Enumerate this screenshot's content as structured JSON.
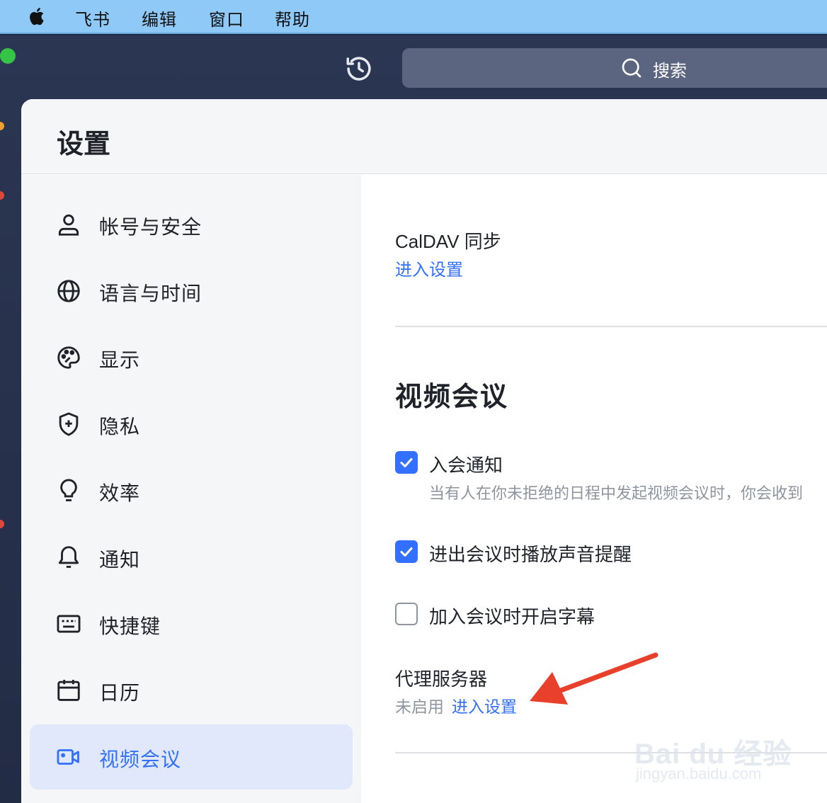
{
  "menubar": {
    "items": [
      "飞书",
      "编辑",
      "窗口",
      "帮助"
    ]
  },
  "toolbar": {
    "search_label": "搜索"
  },
  "settings": {
    "title": "设置",
    "nav": [
      {
        "label": "帐号与安全",
        "icon": "user-icon"
      },
      {
        "label": "语言与时间",
        "icon": "globe-icon"
      },
      {
        "label": "显示",
        "icon": "palette-icon"
      },
      {
        "label": "隐私",
        "icon": "shield-icon"
      },
      {
        "label": "效率",
        "icon": "lightbulb-icon"
      },
      {
        "label": "通知",
        "icon": "bell-icon"
      },
      {
        "label": "快捷键",
        "icon": "keyboard-icon"
      },
      {
        "label": "日历",
        "icon": "calendar-icon"
      },
      {
        "label": "视频会议",
        "icon": "video-icon",
        "active": true
      }
    ]
  },
  "content": {
    "caldav_title": "CalDAV 同步",
    "caldav_link": "进入设置",
    "section_title": "视频会议",
    "options": [
      {
        "label": "入会通知",
        "checked": true,
        "description": "当有人在你未拒绝的日程中发起视频会议时，你会收到"
      },
      {
        "label": "进出会议时播放声音提醒",
        "checked": true
      },
      {
        "label": "加入会议时开启字幕",
        "checked": false
      }
    ],
    "proxy_title": "代理服务器",
    "proxy_status": "未启用",
    "proxy_link": "进入设置"
  },
  "watermark": {
    "brand": "Bai du 经验",
    "url": "jingyan.baidu.com"
  },
  "colors": {
    "accent": "#3370ff",
    "menubar": "#8ec9f8",
    "annotation_arrow": "#e8402a"
  }
}
